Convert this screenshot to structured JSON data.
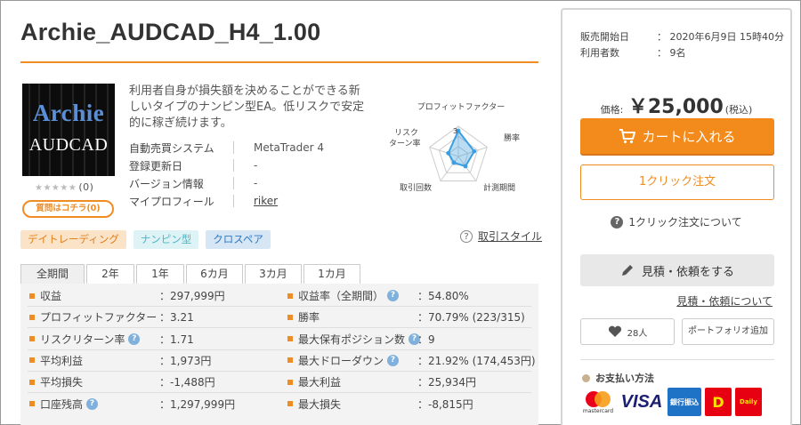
{
  "product": {
    "title": "Archie_AUDCAD_H4_1.00",
    "thumb_line1": "Archie",
    "thumb_line2": "AUDCAD",
    "stars": "★★★★★",
    "review_count": "(0)",
    "question_label": "質問はコチラ(0)",
    "description": "利用者自身が損失額を決めることができる新しいタイプのナンピン型EA。低リスクで安定的に稼ぎ続けます。"
  },
  "specs": [
    {
      "label": "自動売買システム",
      "value": "MetaTrader 4"
    },
    {
      "label": "登録更新日",
      "value": "-"
    },
    {
      "label": "バージョン情報",
      "value": "-"
    },
    {
      "label": "マイプロフィール",
      "value": "riker"
    }
  ],
  "radar": {
    "labels": [
      "プロフィットファクター",
      "勝率",
      "計測期間",
      "取引回数",
      "リスク",
      "ターン率"
    ],
    "scale_label": "3",
    "values": [
      0.85,
      0.55,
      0.4,
      0.25,
      0.35
    ],
    "color": "#3b9ee0"
  },
  "tags": [
    "デイトレーディング",
    "ナンピン型",
    "クロスペア"
  ],
  "trade_style": {
    "q": "?",
    "label": "取引スタイル"
  },
  "tabs": [
    "全期間",
    "2年",
    "1年",
    "6カ月",
    "3カ月",
    "1カ月"
  ],
  "stats": [
    {
      "l_label": "収益",
      "l_help": false,
      "l_value": "：297,999円",
      "r_label": "収益率（全期間）",
      "r_help": true,
      "r_value": "：54.80%"
    },
    {
      "l_label": "プロフィットファクター",
      "l_help": false,
      "l_value": "：3.21",
      "r_label": "勝率",
      "r_help": false,
      "r_value": "：70.79% (223/315)"
    },
    {
      "l_label": "リスクリターン率",
      "l_help": true,
      "l_value": "：1.71",
      "r_label": "最大保有ポジション数",
      "r_help": true,
      "r_value": "：9"
    },
    {
      "l_label": "平均利益",
      "l_help": false,
      "l_value": "：1,973円",
      "r_label": "最大ドローダウン",
      "r_help": true,
      "r_value": "：21.92% (174,453円)"
    },
    {
      "l_label": "平均損失",
      "l_help": false,
      "l_value": "：-1,488円",
      "r_label": "最大利益",
      "r_help": false,
      "r_value": "：25,934円"
    },
    {
      "l_label": "口座残高",
      "l_help": true,
      "l_value": "：1,297,999円",
      "r_label": "最大損失",
      "r_help": false,
      "r_value": "：-8,815円"
    }
  ],
  "sidebar": {
    "sale_start_label": "販売開始日",
    "sale_start_value": "： 2020年6月9日 15時40分",
    "users_label": "利用者数",
    "users_value": "： 9名",
    "price_label": "価格:",
    "price_value": "￥25,000",
    "price_tax": "(税込)",
    "cart_label": "カートに入れる",
    "oneclick_label": "1クリック注文",
    "oneclick_about": "1クリック注文について",
    "quote_label": "見積・依頼をする",
    "quote_about": "見積・依頼について",
    "fav_count": "28人",
    "portfolio_label": "ポートフォリオ追加",
    "payment_title": "お支払い方法",
    "payments": [
      "mastercard",
      "VISA",
      "銀行振込",
      "D",
      "Daily"
    ]
  },
  "colors": {
    "accent": "#f08c24",
    "cart": "#f28a1c",
    "radar": "#3b9ee0"
  }
}
